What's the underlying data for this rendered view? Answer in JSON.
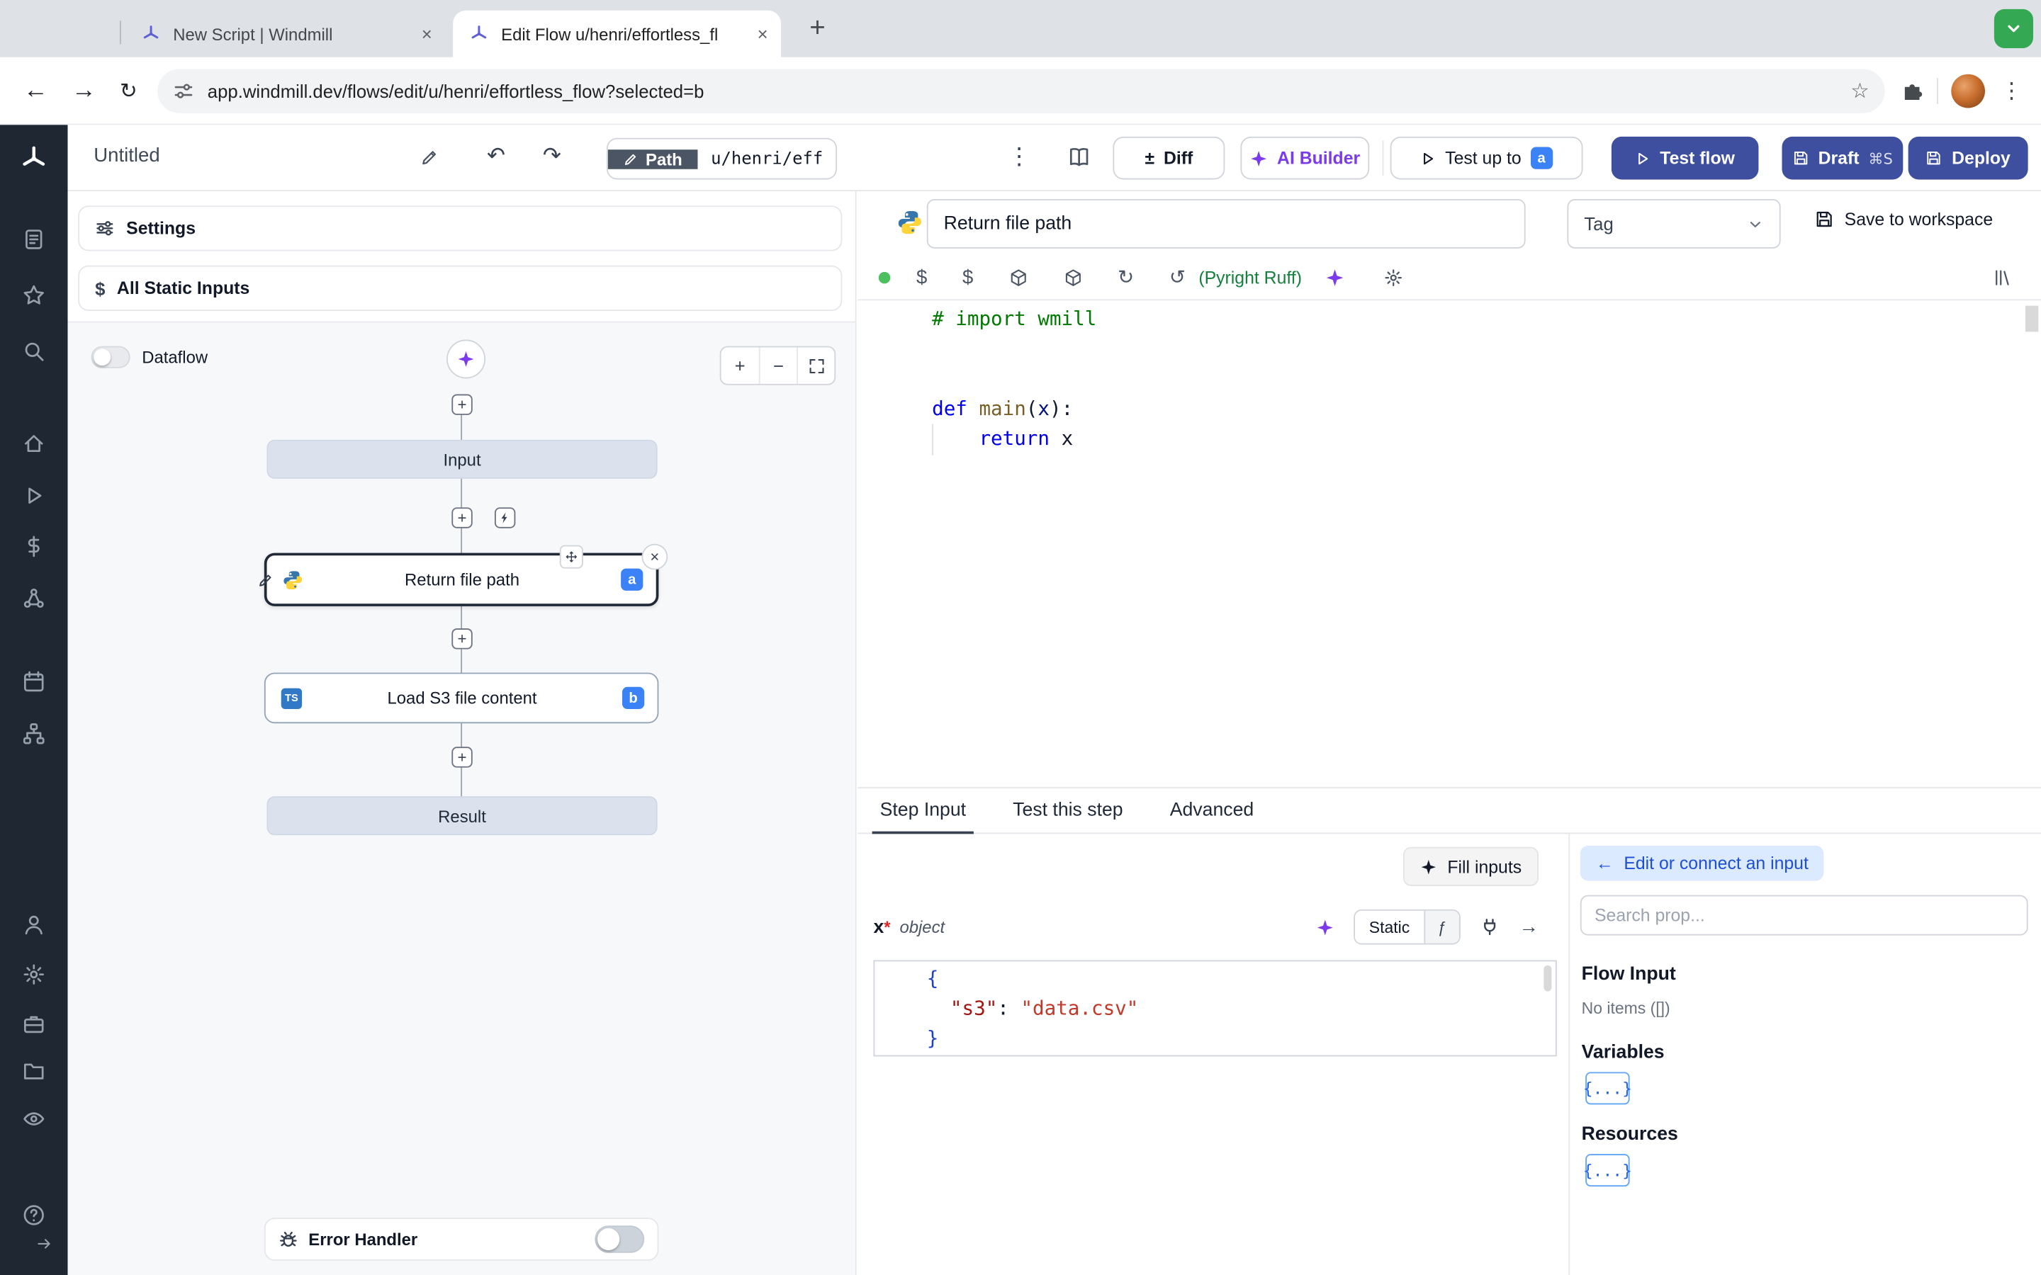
{
  "browser": {
    "tabs": [
      {
        "title": "New Script | Windmill"
      },
      {
        "title": "Edit Flow u/henri/effortless_fl"
      }
    ],
    "url": "app.windmill.dev/flows/edit/u/henri/effortless_flow?selected=b"
  },
  "icons": {
    "back": "←",
    "forward": "→",
    "reload": "↻",
    "kebab": "⋮",
    "undo": "↶",
    "redo": "↷",
    "star": "☆",
    "plus": "+",
    "minus": "−",
    "close": "×",
    "diff": "±",
    "dollar": "$",
    "refresh": "↻",
    "refresh2": "↺",
    "arrow_left": "←",
    "arrow_right": "→",
    "function": "ƒ"
  },
  "header": {
    "title": "Untitled",
    "path_label": "Path",
    "path_value": "u/henri/eff",
    "diff_label": "Diff",
    "ai_builder_label": "AI Builder",
    "test_up_to_label": "Test up to",
    "test_up_to_badge": "a",
    "test_flow_label": "Test flow",
    "draft_label": "Draft",
    "draft_shortcut": "⌘S",
    "deploy_label": "Deploy"
  },
  "flow_panel": {
    "settings_label": "Settings",
    "static_inputs_label": "All Static Inputs",
    "dataflow_label": "Dataflow",
    "error_handler_label": "Error Handler",
    "nodes": {
      "input_label": "Input",
      "step_a_label": "Return file path",
      "step_a_badge": "a",
      "step_b_label": "Load S3 file content",
      "step_b_badge": "b",
      "step_b_lang": "TS",
      "result_label": "Result"
    }
  },
  "editor": {
    "step_name": "Return file path",
    "tag_label": "Tag",
    "save_label": "Save to workspace",
    "lint_label": "(Pyright Ruff)",
    "code_lines": [
      [
        {
          "t": "# import wmill",
          "c": "comment"
        }
      ],
      [],
      [],
      [
        {
          "t": "def",
          "c": "kw"
        },
        {
          "t": " ",
          "c": "pl"
        },
        {
          "t": "main",
          "c": "fn"
        },
        {
          "t": "(",
          "c": "pl"
        },
        {
          "t": "x",
          "c": "param"
        },
        {
          "t": "):",
          "c": "pl"
        }
      ],
      [
        {
          "t": "    ",
          "c": "pl"
        },
        {
          "t": "return",
          "c": "kw"
        },
        {
          "t": " x",
          "c": "pl"
        }
      ]
    ]
  },
  "step_panel": {
    "tabs": [
      "Step Input",
      "Test this step",
      "Advanced"
    ],
    "fill_inputs_label": "Fill inputs",
    "arg_name": "x",
    "arg_required": "*",
    "arg_type": "object",
    "static_label": "Static",
    "json_lines": [
      [
        {
          "t": "{",
          "c": "brace"
        }
      ],
      [
        {
          "t": "  ",
          "c": "pl"
        },
        {
          "t": "\"s3\"",
          "c": "key"
        },
        {
          "t": ": ",
          "c": "pl"
        },
        {
          "t": "\"data.csv\"",
          "c": "str"
        }
      ],
      [
        {
          "t": "}",
          "c": "brace"
        }
      ]
    ]
  },
  "connect_panel": {
    "edit_label": "Edit or connect an input",
    "search_placeholder": "Search prop...",
    "flow_input_label": "Flow Input",
    "no_items_label": "No items ([])",
    "variables_label": "Variables",
    "resources_label": "Resources",
    "braces_label": "{...}"
  },
  "sidebar": {
    "items": [
      "apps",
      "favorites",
      "search",
      "home",
      "runs",
      "variables",
      "resources",
      "schedules",
      "flows",
      "users",
      "settings",
      "workers",
      "folders",
      "audit",
      "help",
      "collapse"
    ]
  },
  "colors": {
    "primary_button_blue": "#3e4f9f",
    "badge_blue": "#3b82f6",
    "ai_violet": "#7c3aed",
    "lint_green": "#15803d",
    "record_green": "#34a853",
    "sidebar_bg": "#1f2733"
  }
}
